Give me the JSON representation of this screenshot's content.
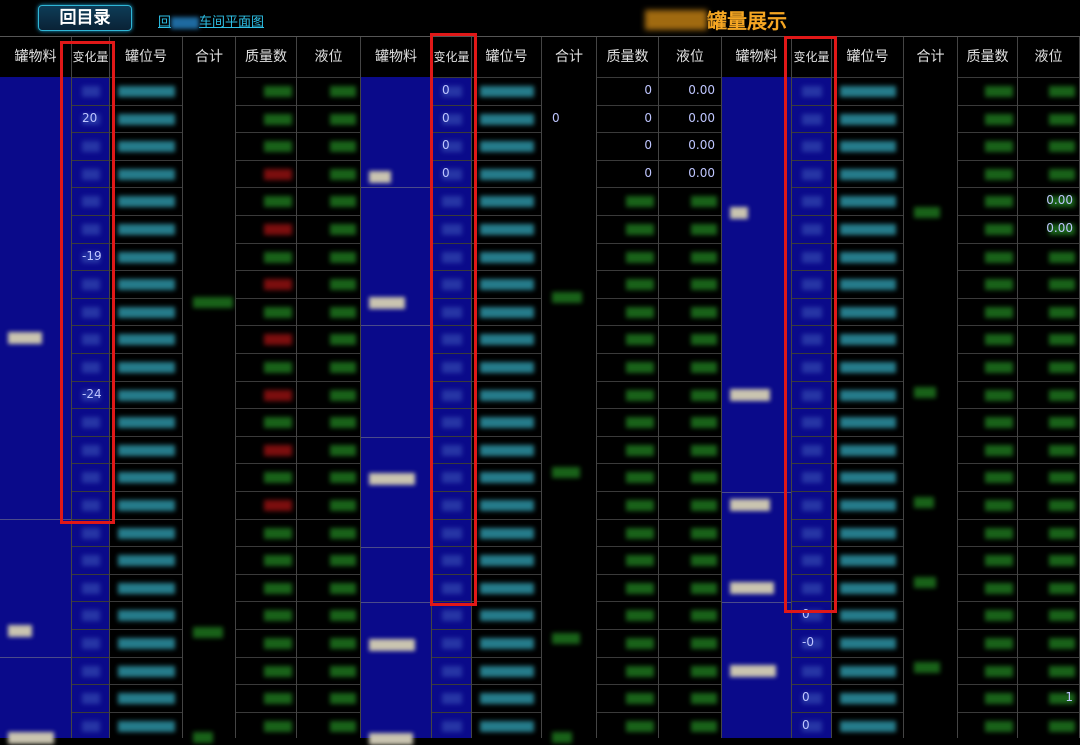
{
  "toolbar": {
    "back_label": "回目录",
    "plan_link_prefix": "回",
    "plan_link_suffix": "车间平面图"
  },
  "page": {
    "title": "罐量展示"
  },
  "columns": [
    "罐物料",
    "变化量",
    "罐位号",
    "合计",
    "质量数",
    "液位"
  ],
  "groups": [
    {
      "id": "group1"
    },
    {
      "id": "group2"
    },
    {
      "id": "group3"
    }
  ],
  "visible_values": {
    "g1_change": [
      "20",
      "-19",
      "-24"
    ],
    "g2_change": [
      "0",
      "0",
      "0",
      "0"
    ],
    "g2_total": "0",
    "g2_mass": [
      "0",
      "0",
      "0",
      "0"
    ],
    "g2_level": [
      "0.00",
      "0.00",
      "0.00",
      "0.00"
    ],
    "g3_change": [
      "0",
      "-0",
      "0",
      "0"
    ],
    "g3_level": [
      "0.00",
      "0.00",
      "1"
    ]
  },
  "colors": {
    "accent": "#f5a623",
    "highlight": "#e01818",
    "material_bg": "#0a0a8a"
  }
}
